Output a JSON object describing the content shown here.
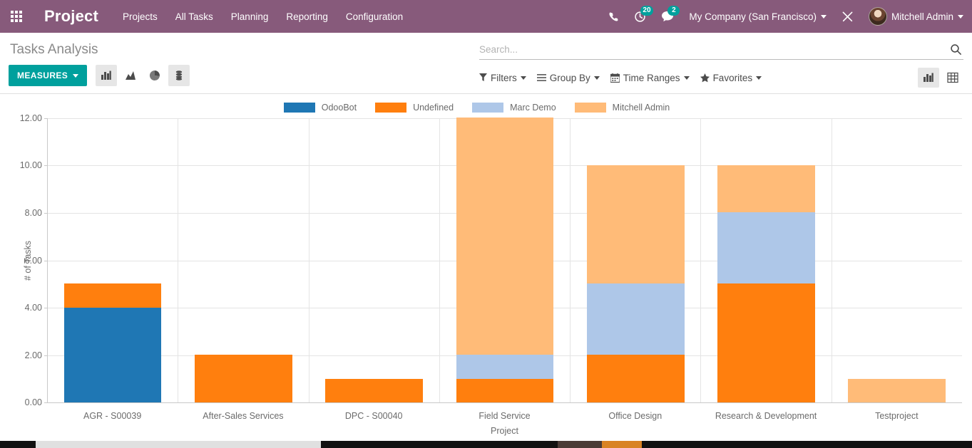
{
  "navbar": {
    "apps_icon": "apps-grid-icon",
    "brand": "Project",
    "menu": [
      {
        "label": "Projects"
      },
      {
        "label": "All Tasks"
      },
      {
        "label": "Planning"
      },
      {
        "label": "Reporting"
      },
      {
        "label": "Configuration"
      }
    ],
    "phone_icon": "phone-icon",
    "activity_icon": "clock-activity-icon",
    "activity_count": "20",
    "messages_icon": "chat-bubble-icon",
    "messages_count": "2",
    "company": "My Company (San Francisco)",
    "debug_icon": "tools-debug-icon",
    "user": "Mitchell Admin",
    "bg_color": "#875a7b"
  },
  "control_panel": {
    "title": "Tasks Analysis",
    "measures_label": "MEASURES",
    "chart_buttons": [
      {
        "name": "bar-chart-icon",
        "active": true
      },
      {
        "name": "line-chart-icon",
        "active": false
      },
      {
        "name": "pie-chart-icon",
        "active": false
      },
      {
        "name": "stacked-database-icon",
        "active": true
      }
    ],
    "search_placeholder": "Search...",
    "search_value": "",
    "search_icon": "search-icon",
    "filters": [
      {
        "label": "Filters",
        "icon": "funnel-icon"
      },
      {
        "label": "Group By",
        "icon": "bars-icon"
      },
      {
        "label": "Time Ranges",
        "icon": "calendar-icon"
      },
      {
        "label": "Favorites",
        "icon": "star-icon"
      }
    ],
    "view_toggles": [
      {
        "name": "graph-view-icon",
        "active": true
      },
      {
        "name": "pivot-view-icon",
        "active": false
      }
    ],
    "accent_color": "#00a09d"
  },
  "chart_data": {
    "type": "bar",
    "stacked": true,
    "title": "",
    "xlabel": "Project",
    "ylabel": "# of Tasks",
    "ylim": [
      0,
      12
    ],
    "yticks": [
      "0.00",
      "2.00",
      "4.00",
      "6.00",
      "8.00",
      "10.00",
      "12.00"
    ],
    "ytick_values": [
      0,
      2,
      4,
      6,
      8,
      10,
      12
    ],
    "grid": true,
    "legend_position": "top",
    "categories": [
      "AGR - S00039",
      "After-Sales Services",
      "DPC - S00040",
      "Field Service",
      "Office Design",
      "Research & Development",
      "Testproject"
    ],
    "series": [
      {
        "name": "OdooBot",
        "color": "#1f77b4",
        "values": [
          4,
          0,
          0,
          0,
          0,
          0,
          0
        ]
      },
      {
        "name": "Undefined",
        "color": "#ff7f0e",
        "values": [
          1,
          2,
          1,
          1,
          2,
          5,
          0
        ]
      },
      {
        "name": "Marc Demo",
        "color": "#aec7e8",
        "values": [
          0,
          0,
          0,
          1,
          3,
          3,
          0
        ]
      },
      {
        "name": "Mitchell Admin",
        "color": "#ffbb78",
        "values": [
          0,
          0,
          0,
          10,
          5,
          2,
          1
        ]
      }
    ],
    "totals": [
      5,
      2,
      1,
      12,
      10,
      10,
      1
    ]
  }
}
